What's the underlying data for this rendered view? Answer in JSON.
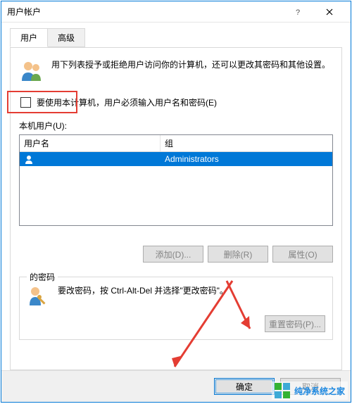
{
  "window": {
    "title": "用户帐户"
  },
  "tabs": [
    {
      "label": "用户",
      "active": true
    },
    {
      "label": "高级",
      "active": false
    }
  ],
  "intro": "用下列表授予或拒绝用户访问你的计算机，还可以更改其密码和其他设置。",
  "checkbox": {
    "label": "要使用本计算机，用户必须输入用户名和密码(E)",
    "checked": false
  },
  "usersLabel": "本机用户(U):",
  "listview": {
    "columns": [
      "用户名",
      "组"
    ],
    "rows": [
      {
        "name": "",
        "group": "Administrators",
        "selected": true
      }
    ]
  },
  "userButtons": {
    "add": "添加(D)...",
    "remove": "删除(R)",
    "properties": "属性(O)"
  },
  "passwordBox": {
    "legend": "的密码",
    "text": "要改密码，按 Ctrl-Alt-Del 并选择\"更改密码\"。",
    "resetBtn": "重置密码(P)..."
  },
  "dialogButtons": {
    "ok": "确定",
    "cancel": "取消"
  },
  "watermark": "纯净系统之家"
}
